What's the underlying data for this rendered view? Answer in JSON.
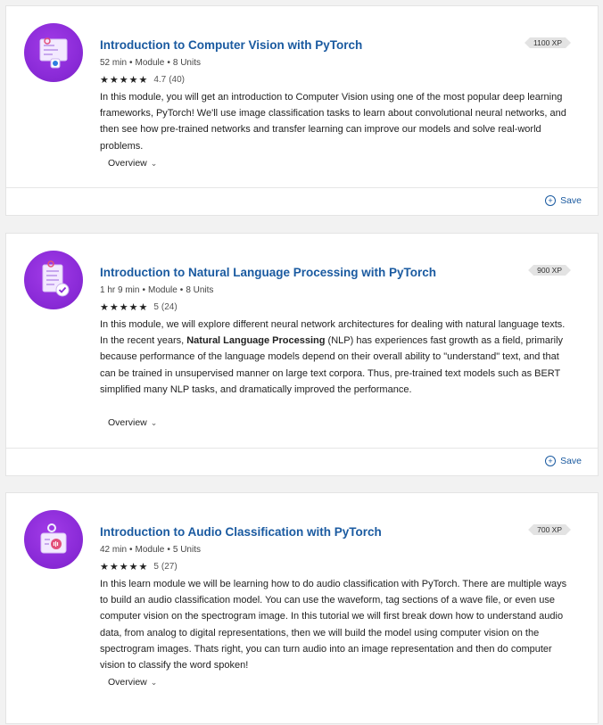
{
  "cards": [
    {
      "title": "Introduction to Computer Vision with PyTorch",
      "duration": "52 min",
      "type": "Module",
      "units": "8 Units",
      "rating": "4.7",
      "rating_count": "(40)",
      "xp": "1100 XP",
      "description_parts": [
        "In this module, you will get an introduction to Computer Vision using one of the most popular deep learning frameworks, PyTorch! We'll use image classification tasks to learn about convolutional neural networks, and then see how pre-trained networks and transfer learning can improve our models and solve real-world problems."
      ],
      "overview_label": "Overview",
      "save_label": "Save",
      "icon": "computer-vision-icon"
    },
    {
      "title": "Introduction to Natural Language Processing with PyTorch",
      "duration": "1 hr 9 min",
      "type": "Module",
      "units": "8 Units",
      "rating": "5",
      "rating_count": "(24)",
      "xp": "900 XP",
      "description_before": "In this module, we will explore different neural network architectures for dealing with natural language texts. In the recent years, ",
      "description_bold": "Natural Language Processing",
      "description_after": " (NLP) has experiences fast growth as a field, primarily because performance of the language models depend on their overall ability to \"understand\" text, and that can be trained in unsupervised manner on large text corpora. Thus, pre-trained text models such as BERT simplified many NLP tasks, and dramatically improved the performance.",
      "overview_label": "Overview",
      "save_label": "Save",
      "icon": "document-check-icon"
    },
    {
      "title": "Introduction to Audio Classification with PyTorch",
      "duration": "42 min",
      "type": "Module",
      "units": "5 Units",
      "rating": "5",
      "rating_count": "(27)",
      "xp": "700 XP",
      "description_parts": [
        "In this learn module we will be learning how to do audio classification with PyTorch. There are multiple ways to build an audio classification model. You can use the waveform, tag sections of a wave file, or even use computer vision on the spectrogram image. In this tutorial we will first break down how to understand audio data, from analog to digital representations, then we will build the model using computer vision on the spectrogram images. Thats right, you can turn audio into an image representation and then do computer vision to classify the word spoken!"
      ],
      "overview_label": "Overview",
      "icon": "audio-badge-icon"
    }
  ],
  "stars": "★★★★★",
  "bullet": "•",
  "colors": {
    "title": "#1a5aa0",
    "icon_bg": "#8b2bd8",
    "xp_bg": "#e3e3e3"
  }
}
